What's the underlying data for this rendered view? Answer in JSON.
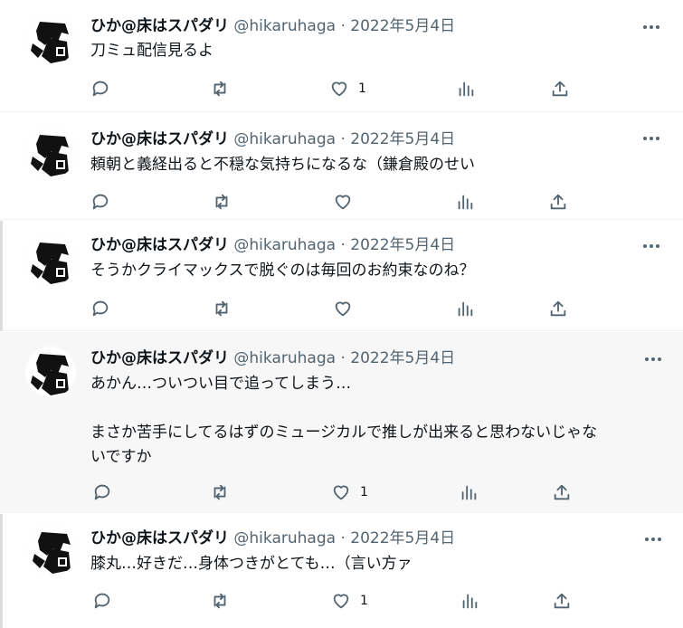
{
  "user": {
    "display_name": "ひか@床はスパダリ",
    "handle": "@hikaruhaga",
    "separator": "·"
  },
  "icons": {
    "reply": "reply-icon",
    "retweet": "retweet-icon",
    "like": "like-icon",
    "views": "views-icon",
    "share": "share-icon",
    "more": "more-icon"
  },
  "colors": {
    "text": "#0f1419",
    "secondary": "#536471",
    "divider": "#eff3f4",
    "highlight_bg": "#f7f7f7"
  },
  "tweets": [
    {
      "date": "2022年5月4日",
      "text": "刀ミュ配信見るよ",
      "likes": "1"
    },
    {
      "date": "2022年5月4日",
      "text": "頼朝と義経出ると不穏な気持ちになるな（鎌倉殿のせい",
      "likes": ""
    },
    {
      "date": "2022年5月4日",
      "text": "そうかクライマックスで脱ぐのは毎回のお約束なのね？",
      "likes": ""
    },
    {
      "date": "2022年5月4日",
      "text": "あかん…ついつい目で追ってしまう…\n\nまさか苦手にしてるはずのミュージカルで推しが出来ると思わないじゃな\nいですか",
      "likes": "1"
    },
    {
      "date": "2022年5月4日",
      "text": "膝丸…好きだ…身体つきがとても…（言い方ァ",
      "likes": "1"
    }
  ]
}
